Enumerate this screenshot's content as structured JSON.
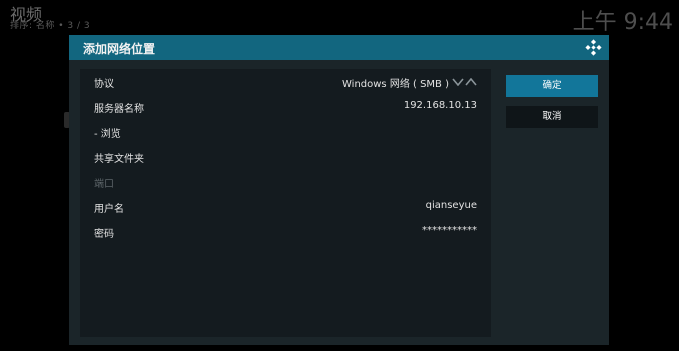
{
  "background": {
    "title": "视频",
    "subtitle": "排序: 名称 • 3 / 3",
    "clock": "上午 9:44"
  },
  "dialog": {
    "title": "添加网络位置",
    "logo_icon": "kodi-logo-icon",
    "accent_color": "#12667f",
    "rows": [
      {
        "label": "协议",
        "value": "Windows 网络 ( SMB )"
      },
      {
        "label": "服务器名称",
        "value": "192.168.10.13"
      },
      {
        "label": "- 浏览",
        "value": ""
      },
      {
        "label": "共享文件夹",
        "value": ""
      },
      {
        "label": "端口",
        "value": ""
      },
      {
        "label": "用户名",
        "value": "qianseyue"
      },
      {
        "label": "密码",
        "value": "***********"
      }
    ],
    "ok_label": "确定",
    "cancel_label": "取消"
  }
}
